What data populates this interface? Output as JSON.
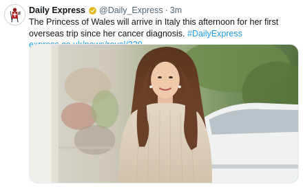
{
  "tweet": {
    "author_name": "Daily Express",
    "author_handle": "@Daily_Express",
    "separator": "·",
    "time": "3m",
    "text": "The Princess of Wales will arrive in Italy this afternoon for her first overseas trip since her cancer diagnosis.",
    "hashtag": "#DailyExpress",
    "link_text": "express.co.uk/news/royal/220…"
  },
  "icons": {
    "avatar": "daily-express-crusader-logo",
    "verified": "gold-verified-badge"
  },
  "colors": {
    "link": "#1d9bf0",
    "verified_gold": "#e2b719",
    "text_secondary": "#536471"
  }
}
